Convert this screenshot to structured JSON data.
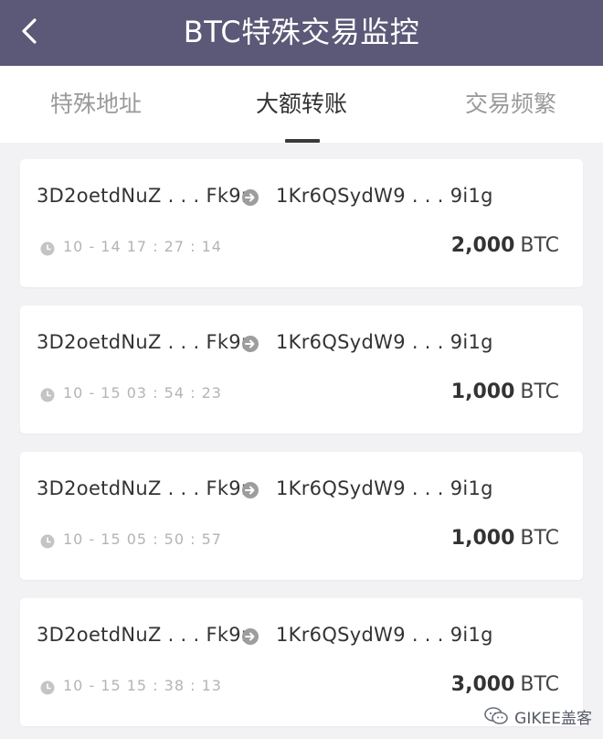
{
  "header": {
    "title": "BTC特殊交易监控",
    "back_icon": "chevron-left-icon"
  },
  "tabs": [
    {
      "label": "特殊地址",
      "active": false
    },
    {
      "label": "大额转账",
      "active": true
    },
    {
      "label": "交易频繁",
      "active": false
    }
  ],
  "transfers": [
    {
      "from": "3D2oetdNuZ . . . Fk9r",
      "to": "1Kr6QSydW9 . . . 9i1g",
      "time": "10 - 14   17 : 27 : 14",
      "amount": "2,000",
      "unit": "BTC"
    },
    {
      "from": "3D2oetdNuZ . . . Fk9r",
      "to": "1Kr6QSydW9 . . . 9i1g",
      "time": "10 - 15   03 : 54 : 23",
      "amount": "1,000",
      "unit": "BTC"
    },
    {
      "from": "3D2oetdNuZ . . . Fk9r",
      "to": "1Kr6QSydW9 . . . 9i1g",
      "time": "10 - 15   05 : 50 : 57",
      "amount": "1,000",
      "unit": "BTC"
    },
    {
      "from": "3D2oetdNuZ . . . Fk9r",
      "to": "1Kr6QSydW9 . . . 9i1g",
      "time": "10 - 15   15 : 38 : 13",
      "amount": "3,000",
      "unit": "BTC"
    }
  ],
  "watermark": {
    "text": "GIKEE盖客",
    "icon": "wechat-icon"
  },
  "colors": {
    "header_bg": "#5c5877",
    "page_bg": "#f2f2f4",
    "card_bg": "#ffffff",
    "active_tab": "#333333",
    "inactive_tab": "#9a9a9a"
  }
}
